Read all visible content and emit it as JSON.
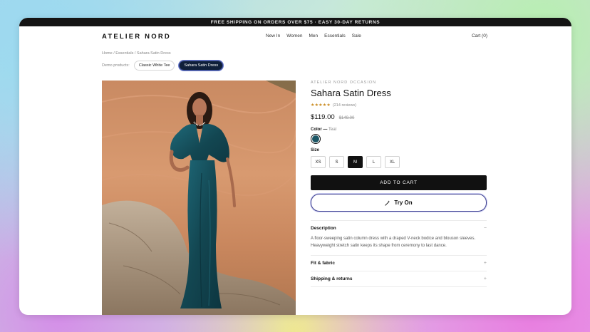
{
  "promo_bar": "FREE SHIPPING ON ORDERS OVER $75 · EASY 30-DAY RETURNS",
  "header": {
    "logo": "ATELIER NORD",
    "nav": [
      "New In",
      "Women",
      "Men",
      "Essentials",
      "Sale"
    ],
    "cart": "Cart (0)"
  },
  "breadcrumb": "Home / Essentials / Sahara Satin Dress",
  "demo": {
    "label": "Demo products:",
    "options": [
      "Classic White Tee",
      "Sahara Satin Dress"
    ],
    "active_index": 1
  },
  "product": {
    "brand": "ATELIER NORD OCCASION",
    "title": "Sahara Satin Dress",
    "stars": "★★★★★",
    "reviews": "(214 reviews)",
    "price": "$119.00",
    "compare_price": "$149.00",
    "color_label": "Color —",
    "color_value": "Teal",
    "swatch_color": "#1b5665",
    "size_label": "Size",
    "sizes": [
      "XS",
      "S",
      "M",
      "L",
      "XL"
    ],
    "selected_size": "M",
    "add_to_cart": "ADD TO CART",
    "try_on": "Try On",
    "try_on_icon": "magic-wand-icon"
  },
  "accordion": [
    {
      "title": "Description",
      "indicator": "−",
      "body": "A floor-sweeping satin column dress with a draped V-neck bodice and blouson sleeves. Heavyweight stretch satin keeps its shape from ceremony to last dance."
    },
    {
      "title": "Fit & fabric",
      "indicator": "+"
    },
    {
      "title": "Shipping & returns",
      "indicator": "+"
    }
  ],
  "colors": {
    "accent": "#111111",
    "try_on_border": "#3d3f8f",
    "active_chip": "#0f1f3a",
    "star": "#c98a1e"
  }
}
